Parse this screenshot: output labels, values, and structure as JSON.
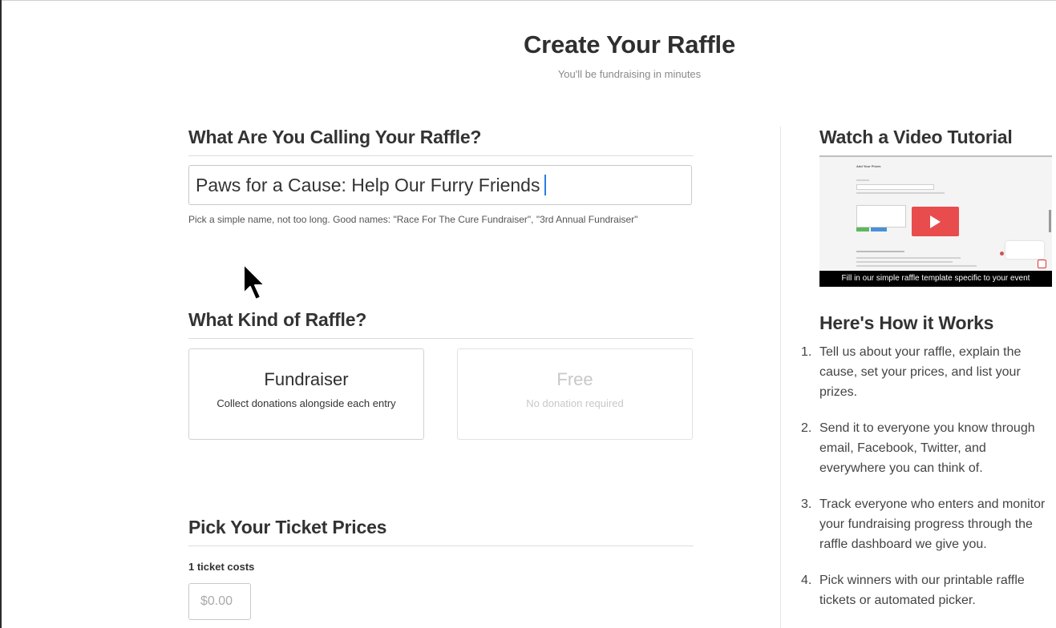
{
  "page": {
    "title": "Create Your Raffle",
    "subtitle": "You'll be fundraising in minutes"
  },
  "name_section": {
    "heading": "What Are You Calling Your Raffle?",
    "input_value": "Paws for a Cause: Help Our Furry Friends",
    "helper": "Pick a simple name, not too long. Good names: \"Race For The Cure Fundraiser\", \"3rd Annual Fundraiser\""
  },
  "kind_section": {
    "heading": "What Kind of Raffle?",
    "options": [
      {
        "title": "Fundraiser",
        "description": "Collect donations alongside each entry",
        "selected": true
      },
      {
        "title": "Free",
        "description": "No donation required",
        "selected": false
      }
    ]
  },
  "price_section": {
    "heading": "Pick Your Ticket Prices",
    "ticket_label": "1 ticket costs",
    "price_placeholder": "$0.00"
  },
  "video": {
    "heading": "Watch a Video Tutorial",
    "caption": "Fill in our simple raffle template specific to your event",
    "thumb_title": "Add Your Prizes",
    "play_color": "#e84c4c"
  },
  "how": {
    "heading": "Here's How it Works",
    "steps": [
      {
        "num": "1.",
        "lines": [
          "Tell us about your raffle, explain the",
          "cause, set your prices, and list your",
          "prizes."
        ]
      },
      {
        "num": "2.",
        "lines": [
          "Send it to everyone you know through",
          "email, Facebook, Twitter, and",
          "everywhere you can think of."
        ]
      },
      {
        "num": "3.",
        "lines": [
          "Track everyone who enters and monitor",
          "your fundraising progress through the",
          "raffle dashboard we give you."
        ]
      },
      {
        "num": "4.",
        "lines": [
          "Pick winners with our printable raffle",
          "tickets or automated picker."
        ]
      }
    ]
  }
}
